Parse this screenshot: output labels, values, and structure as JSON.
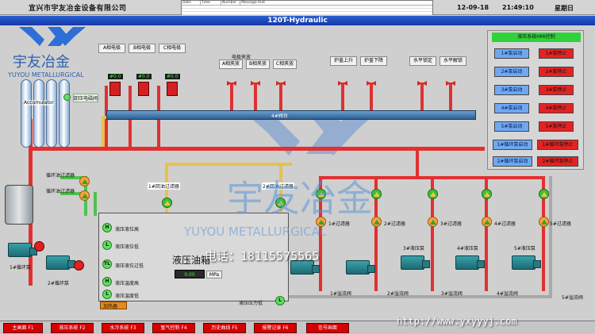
{
  "header": {
    "company": "宜兴市宇友冶金设备有限公司",
    "alarm_columns": [
      "Date",
      "Time",
      "Number",
      "Message text"
    ],
    "date": "12-09-18",
    "time": "21:49:10",
    "weekday": "星期日"
  },
  "title": "120T-Hydraulic",
  "watermark": {
    "cn": "宇友冶金",
    "en": "YUYOU METALLURGICAL",
    "phone": "电话：18115575565",
    "url": "http://www.yxyyyj.com"
  },
  "electrodes": [
    "A相电极",
    "B相电极",
    "C相电极"
  ],
  "electrode_readouts": [
    "#0.0",
    "#0.0",
    "#0.0"
  ],
  "clamp_group_label": "电极夹放",
  "clamps": [
    "A相夹放",
    "B相夹放",
    "C相夹放"
  ],
  "furnace_cover": [
    "炉盖上升",
    "炉盖下降"
  ],
  "horizontal": [
    "水平锁定",
    "水平解锁"
  ],
  "accumulator": "Accumulator",
  "accumulator_valve": "卸压电磁阀",
  "valve_stand": "4#阀台",
  "loop_filters": [
    "循环油过滤器",
    "循环油过滤器"
  ],
  "return_filters": [
    "1#回油过滤器",
    "2#回油过滤器"
  ],
  "circ_pumps": [
    "1#循环泵",
    "2#循环泵"
  ],
  "tank": {
    "title": "液压油箱",
    "value": "0.00",
    "unit": "MPa",
    "pressure_label": "液压压力低",
    "indicators": [
      {
        "code": "H",
        "label": "液压液位高"
      },
      {
        "code": "L",
        "label": "液压液位低"
      },
      {
        "code": "TL",
        "label": "液压液位过低"
      },
      {
        "code": "H",
        "label": "液压温度高"
      },
      {
        "code": "L",
        "label": "液压温度低"
      }
    ],
    "pressure_code": "L",
    "heater": "加热器"
  },
  "pump_filters": [
    "1#过滤器",
    "2#过滤器",
    "3#过滤器",
    "4#过滤器",
    "5#过滤器"
  ],
  "main_pumps": [
    "3#液压泵",
    "4#液压泵",
    "5#液压泵"
  ],
  "overflow_valves": [
    "1#溢流阀",
    "2#溢流阀",
    "3#溢流阀",
    "4#溢流阀",
    "5#溢流阀"
  ],
  "hmi": {
    "title": "液压系统HMI控制",
    "rows": [
      {
        "start": "1#泵启动",
        "stop": "1#泵停止"
      },
      {
        "start": "2#泵启动",
        "stop": "2#泵停止"
      },
      {
        "start": "3#泵启动",
        "stop": "3#泵停止"
      },
      {
        "start": "4#泵启动",
        "stop": "4#泵停止"
      },
      {
        "start": "5#泵启动",
        "stop": "5#泵停止"
      },
      {
        "start": "1#循环泵启动",
        "stop": "1#循环泵停止"
      },
      {
        "start": "2#循环泵启动",
        "stop": "2#循环泵停止"
      }
    ]
  },
  "fkeys": [
    "主画面 F1",
    "液压系统 F2",
    "水冷系统 F3",
    "氩气控制 F4",
    "历史曲线 F5",
    "报警记录 F6",
    "信号画面"
  ],
  "colors": {
    "oil_supply": "#e23030",
    "oil_return": "#e6c14d",
    "circulation": "#4fc24f",
    "title_bar": "#1f48be",
    "fkey": "#d40000"
  }
}
